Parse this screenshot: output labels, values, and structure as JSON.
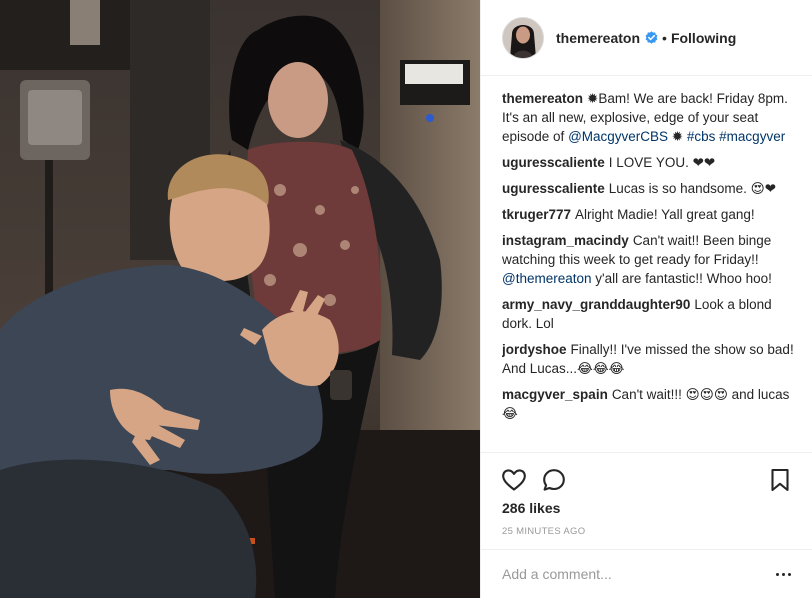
{
  "post": {
    "author": "themereaton",
    "follow_status": "Following",
    "separator": "•",
    "likes": "286 likes",
    "time_ago": "25 MINUTES AGO",
    "comment_placeholder": "Add a comment...",
    "caption": {
      "user": "themereaton",
      "text_1": "✹Bam! We are back! Friday 8pm. It's an all new, explosive, edge of your seat episode of ",
      "mention": "@MacgyverCBS",
      "text_2": " ✹ ",
      "tag_1": "#cbs",
      "text_3": " ",
      "tag_2": "#macgyver"
    },
    "comments": [
      {
        "user": "uguresscaliente",
        "text": "I LOVE YOU. ❤❤"
      },
      {
        "user": "uguresscaliente",
        "text": "Lucas is so handsome. 😍❤"
      },
      {
        "user": "tkruger777",
        "text": "Alright Madie! Yall great gang!"
      },
      {
        "user": "instagram_macindy",
        "text_1": "Can't wait!! Been binge watching this week to get ready for Friday!! ",
        "mention": "@themereaton",
        "text_2": " y'all are fantastic!! Whoo hoo!"
      },
      {
        "user": "army_navy_granddaughter90",
        "text": "Look a blond dork. Lol"
      },
      {
        "user": "jordyshoe",
        "text": "Finally!! I've missed the show so bad! And Lucas...😂😂😂"
      },
      {
        "user": "macgyver_spain",
        "text": "Can't wait!!! 😍😍😍 and lucas 😂"
      }
    ]
  },
  "icons": {
    "verified": "verified-badge-icon",
    "like": "heart-icon",
    "comment": "comment-bubble-icon",
    "save": "bookmark-icon",
    "more": "more-options-icon"
  },
  "colors": {
    "text": "#262626",
    "link": "#003569",
    "muted": "#999999",
    "verified": "#3897f0",
    "border": "#efefef"
  }
}
